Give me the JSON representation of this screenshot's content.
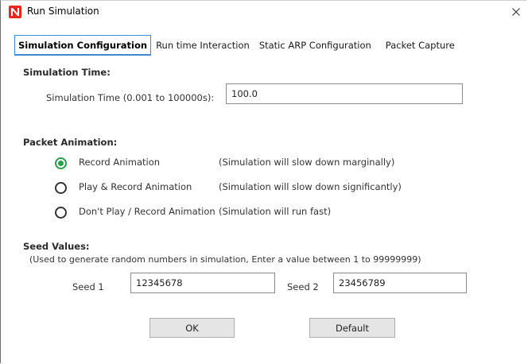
{
  "window": {
    "title": "Run Simulation",
    "icon": "netsim-app-icon",
    "close_glyph": "✕"
  },
  "tabs": [
    {
      "label": "Simulation Configuration",
      "active": true
    },
    {
      "label": "Run time Interaction",
      "active": false
    },
    {
      "label": "Static ARP Configuration",
      "active": false
    },
    {
      "label": "Packet Capture",
      "active": false
    }
  ],
  "simulation_time": {
    "heading": "Simulation Time:",
    "label": "Simulation Time (0.001 to 100000s):",
    "value": "100.0"
  },
  "packet_animation": {
    "heading": "Packet Animation:",
    "options": [
      {
        "label": "Record Animation",
        "note": "(Simulation will slow down marginally)",
        "selected": true
      },
      {
        "label": "Play & Record Animation",
        "note": "(Simulation will slow down significantly)",
        "selected": false
      },
      {
        "label": "Don't Play / Record Animation",
        "note": "(Simulation will run fast)",
        "selected": false
      }
    ]
  },
  "seed_values": {
    "heading": "Seed Values:",
    "hint": "(Used to generate random numbers in simulation, Enter a value between 1 to 99999999)",
    "seed1_label": "Seed 1",
    "seed1_value": "12345678",
    "seed2_label": "Seed 2",
    "seed2_value": "23456789"
  },
  "buttons": {
    "ok_label": "OK",
    "default_label": "Default"
  },
  "colors": {
    "accent_tab": "#3d8bd0",
    "radio_selected": "#2a9d4a",
    "app_icon": "#e8281e"
  }
}
